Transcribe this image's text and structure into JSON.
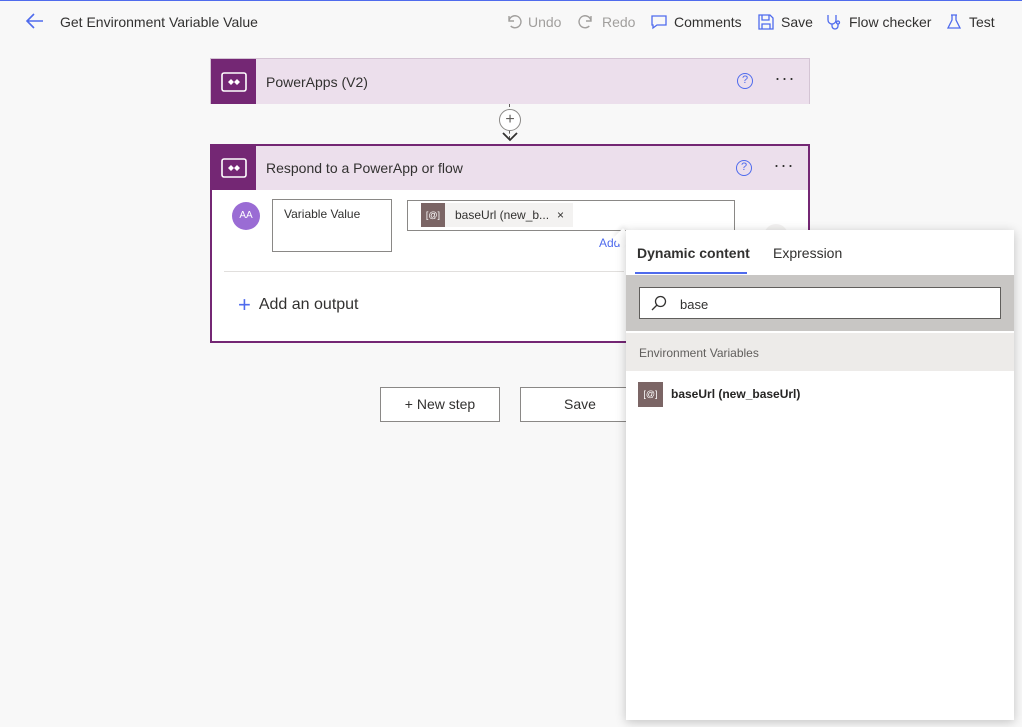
{
  "header": {
    "title": "Get Environment Variable Value",
    "undo": "Undo",
    "redo": "Redo",
    "comments": "Comments",
    "save": "Save",
    "flow_checker": "Flow checker",
    "test": "Test"
  },
  "trigger_card": {
    "title": "PowerApps (V2)"
  },
  "respond_card": {
    "title": "Respond to a PowerApp or flow",
    "avatar": "AA",
    "variable_name": "Variable Value",
    "token_label": "baseUrl (new_b...",
    "token_close": "×",
    "add_link": "Add",
    "add_output": "Add an output"
  },
  "steps": {
    "new_step": "+ New step",
    "save": "Save"
  },
  "flyout": {
    "tab_dynamic": "Dynamic content",
    "tab_expression": "Expression",
    "search_value": "base",
    "section": "Environment Variables",
    "result_label": "baseUrl (new_baseUrl)",
    "token_glyph": "[@]"
  },
  "colors": {
    "accent": "#4f6bed",
    "powerapps_purple": "#742774",
    "header_tint": "#ecdfec",
    "token_brown": "#7b6565"
  }
}
